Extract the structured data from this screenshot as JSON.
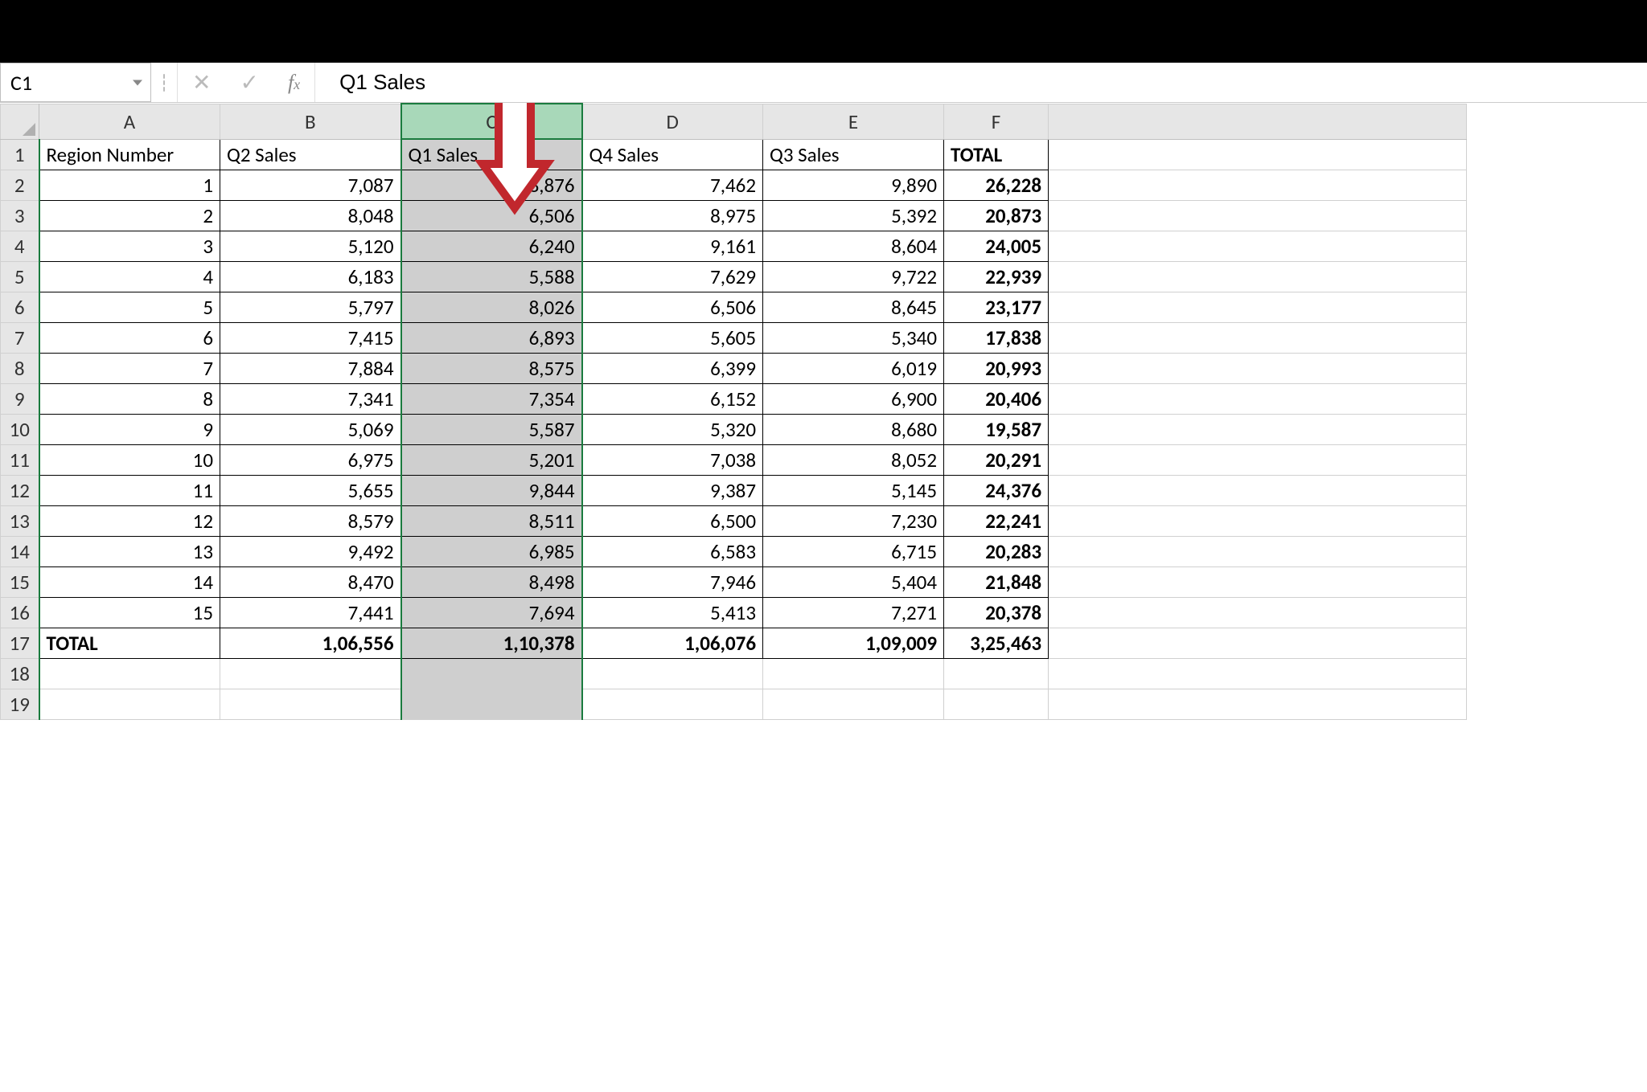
{
  "name_box": "C1",
  "formula_value": "Q1 Sales",
  "columns": [
    "A",
    "B",
    "C",
    "D",
    "E",
    "F"
  ],
  "selected_column": "C",
  "headers": {
    "A": "Region Number",
    "B": "Q2 Sales",
    "C": "Q1 Sales",
    "D": "Q4 Sales",
    "E": "Q3 Sales",
    "F": "TOTAL"
  },
  "rows": [
    {
      "A": "1",
      "B": "7,087",
      "C": "8,876",
      "D": "7,462",
      "E": "9,890",
      "F": "26,228"
    },
    {
      "A": "2",
      "B": "8,048",
      "C": "6,506",
      "D": "8,975",
      "E": "5,392",
      "F": "20,873"
    },
    {
      "A": "3",
      "B": "5,120",
      "C": "6,240",
      "D": "9,161",
      "E": "8,604",
      "F": "24,005"
    },
    {
      "A": "4",
      "B": "6,183",
      "C": "5,588",
      "D": "7,629",
      "E": "9,722",
      "F": "22,939"
    },
    {
      "A": "5",
      "B": "5,797",
      "C": "8,026",
      "D": "6,506",
      "E": "8,645",
      "F": "23,177"
    },
    {
      "A": "6",
      "B": "7,415",
      "C": "6,893",
      "D": "5,605",
      "E": "5,340",
      "F": "17,838"
    },
    {
      "A": "7",
      "B": "7,884",
      "C": "8,575",
      "D": "6,399",
      "E": "6,019",
      "F": "20,993"
    },
    {
      "A": "8",
      "B": "7,341",
      "C": "7,354",
      "D": "6,152",
      "E": "6,900",
      "F": "20,406"
    },
    {
      "A": "9",
      "B": "5,069",
      "C": "5,587",
      "D": "5,320",
      "E": "8,680",
      "F": "19,587"
    },
    {
      "A": "10",
      "B": "6,975",
      "C": "5,201",
      "D": "7,038",
      "E": "8,052",
      "F": "20,291"
    },
    {
      "A": "11",
      "B": "5,655",
      "C": "9,844",
      "D": "9,387",
      "E": "5,145",
      "F": "24,376"
    },
    {
      "A": "12",
      "B": "8,579",
      "C": "8,511",
      "D": "6,500",
      "E": "7,230",
      "F": "22,241"
    },
    {
      "A": "13",
      "B": "9,492",
      "C": "6,985",
      "D": "6,583",
      "E": "6,715",
      "F": "20,283"
    },
    {
      "A": "14",
      "B": "8,470",
      "C": "8,498",
      "D": "7,946",
      "E": "5,404",
      "F": "21,848"
    },
    {
      "A": "15",
      "B": "7,441",
      "C": "7,694",
      "D": "5,413",
      "E": "7,271",
      "F": "20,378"
    }
  ],
  "totals": {
    "label": "TOTAL",
    "B": "1,06,556",
    "C": "1,10,378",
    "D": "1,06,076",
    "E": "1,09,009",
    "F": "3,25,463"
  },
  "row_numbers_shown": 19
}
